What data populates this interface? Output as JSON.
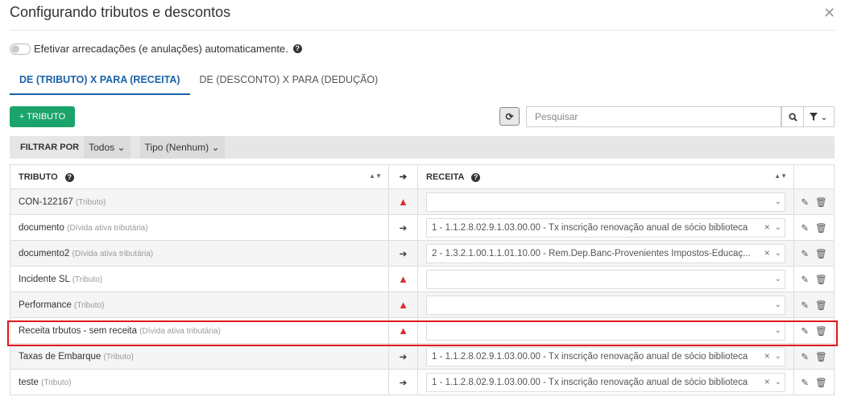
{
  "dialog": {
    "title": "Configurando tributos e descontos",
    "close_icon": "close-icon"
  },
  "toggle": {
    "label": "Efetivar arrecadações (e anulações) automaticamente.",
    "help": "?"
  },
  "tabs": [
    {
      "label": "DE (TRIBUTO) X PARA (RECEITA)",
      "active": true
    },
    {
      "label": "DE (DESCONTO) X PARA (DEDUÇÃO)",
      "active": false
    }
  ],
  "toolbar": {
    "add_label": "+ TRIBUTO",
    "search_placeholder": "Pesquisar"
  },
  "filters": {
    "label": "FILTRAR POR",
    "todos": "Todos",
    "tipo": "Tipo (Nenhum)"
  },
  "table": {
    "col_tributo": "TRIBUTO",
    "col_receita": "RECEITA",
    "rows": [
      {
        "name": "CON-122167",
        "type": "(Tributo)",
        "status": "warning",
        "receita": ""
      },
      {
        "name": "documento",
        "type": "(Dívida ativa tributária)",
        "status": "arrow",
        "receita": "1 - 1.1.2.8.02.9.1.03.00.00 - Tx inscrição renovação anual de sócio biblioteca"
      },
      {
        "name": "documento2",
        "type": "(Dívida ativa tributária)",
        "status": "arrow",
        "receita": "2 - 1.3.2.1.00.1.1.01.10.00 - Rem.Dep.Banc-Provenientes Impostos-Educaç..."
      },
      {
        "name": "Incidente SL",
        "type": "(Tributo)",
        "status": "warning",
        "receita": ""
      },
      {
        "name": "Performance",
        "type": "(Tributo)",
        "status": "warning",
        "receita": ""
      },
      {
        "name": "Receita trbutos - sem receita",
        "type": "(Dívida ativa tributária)",
        "status": "warning",
        "receita": ""
      },
      {
        "name": "Taxas de Embarque",
        "type": "(Tributo)",
        "status": "arrow",
        "receita": "1 - 1.1.2.8.02.9.1.03.00.00 - Tx inscrição renovação anual de sócio biblioteca"
      },
      {
        "name": "teste",
        "type": "(Tributo)",
        "status": "arrow",
        "receita": "1 - 1.1.2.8.02.9.1.03.00.00 - Tx inscrição renovação anual de sócio biblioteca"
      }
    ]
  },
  "colors": {
    "accent": "#1a62a8",
    "add_button": "#1aa36b",
    "warning": "#d9302f",
    "highlight": "#e0161b"
  }
}
